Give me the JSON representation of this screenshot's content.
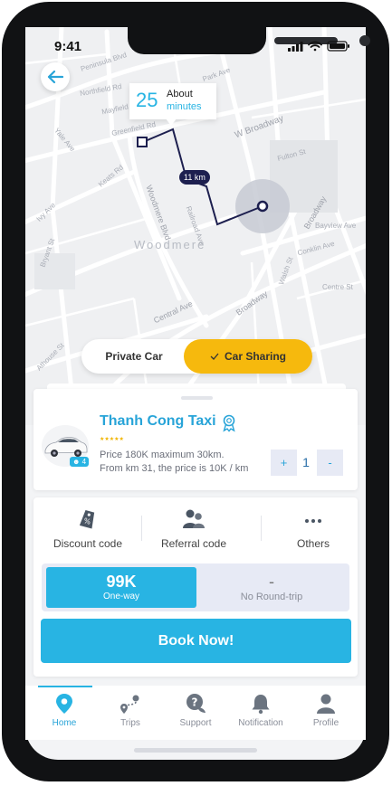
{
  "status": {
    "time": "9:41"
  },
  "map": {
    "streets": [
      "Peninsula Blvd",
      "Northfield Rd",
      "Mayfield Rd",
      "Greenfield Rd",
      "Park Ave",
      "Roselle Pl",
      "Morris Pl",
      "Fairview Pl",
      "Mill Rd",
      "Doyle Ave",
      "Ocean Ave",
      "W Broadway",
      "Fulton St",
      "Yale Ave",
      "Dartmouth Ave",
      "Keats Rd",
      "Woodmere Blvd",
      "Railroad Ave",
      "Ibsen St",
      "Harbor Rd",
      "Broadway",
      "Bayview Ave",
      "Conklin Ave",
      "Rowe Rd",
      "Dickens St",
      "Ivy Ave",
      "Bryant St",
      "Central Ave",
      "Linda Ln",
      "Walsh St",
      "Centre St",
      "Pine St",
      "Auburn Ave",
      "Athouse St"
    ],
    "area_label": "Woodmere",
    "eta_value": "25",
    "eta_line1": "About",
    "eta_line2": "minutes",
    "distance": "11 km"
  },
  "ride_toggle": {
    "private_label": "Private Car",
    "sharing_label": "Car Sharing",
    "selected": "Car Sharing"
  },
  "taxi": {
    "name": "Thanh Cong Taxi",
    "rating": "★★★★★",
    "seats": "4",
    "price_line1": "Price 180K maximum 30km.",
    "price_line2": "From km 31, the price is 10K / km",
    "quantity": "1",
    "plus_label": "+",
    "minus_label": "-"
  },
  "options": [
    {
      "label": "Discount code",
      "icon": "discount-tag-icon"
    },
    {
      "label": "Referral code",
      "icon": "referral-people-icon"
    },
    {
      "label": "Others",
      "icon": "more-icon"
    }
  ],
  "fare": {
    "oneway_price": "99K",
    "oneway_label": "One-way",
    "roundtrip_price": "-",
    "roundtrip_label": "No Round-trip"
  },
  "book_label": "Book Now!",
  "nav": [
    {
      "label": "Home",
      "icon": "location-pin-icon",
      "active": true
    },
    {
      "label": "Trips",
      "icon": "route-icon",
      "active": false
    },
    {
      "label": "Support",
      "icon": "support-chat-icon",
      "active": false
    },
    {
      "label": "Notification",
      "icon": "bell-icon",
      "active": false
    },
    {
      "label": "Profile",
      "icon": "user-icon",
      "active": false
    }
  ],
  "colors": {
    "accent": "#28b4e3",
    "highlight": "#f6b90d",
    "route": "#1d1f4f"
  }
}
